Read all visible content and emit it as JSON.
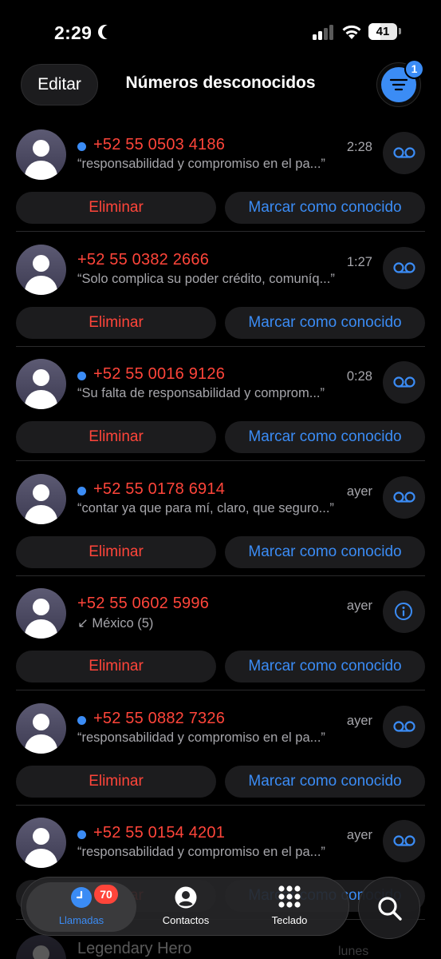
{
  "status_bar": {
    "time": "2:29",
    "battery": "41",
    "battery_level": 0.41
  },
  "header": {
    "edit_label": "Editar",
    "title": "Números desconocidos",
    "filter_badge": "1"
  },
  "actions": {
    "delete_label": "Eliminar",
    "mark_known_label": "Marcar como conocido"
  },
  "calls": [
    {
      "number": "+52 55 0503 4186",
      "subtitle": "“responsabilidad y compromiso en el pa...”",
      "time": "2:28",
      "unread": true,
      "side_icon": "voicemail-icon"
    },
    {
      "number": "+52 55 0382 2666",
      "subtitle": "“Solo complica su poder crédito, comuníq...”",
      "time": "1:27",
      "unread": false,
      "side_icon": "voicemail-icon"
    },
    {
      "number": "+52 55 0016 9126",
      "subtitle": "“Su falta de responsabilidad y comprom...”",
      "time": "0:28",
      "unread": true,
      "side_icon": "voicemail-icon"
    },
    {
      "number": "+52 55 0178 6914",
      "subtitle": "“contar ya que para mí, claro, que seguro...”",
      "time": "ayer",
      "unread": true,
      "side_icon": "voicemail-icon"
    },
    {
      "number": "+52 55 0602 5996",
      "subtitle": "↙ México (5)",
      "time": "ayer",
      "unread": false,
      "side_icon": "info-icon"
    },
    {
      "number": "+52 55 0882 7326",
      "subtitle": "“responsabilidad y compromiso en el pa...”",
      "time": "ayer",
      "unread": true,
      "side_icon": "voicemail-icon"
    },
    {
      "number": "+52 55 0154 4201",
      "subtitle": "“responsabilidad y compromiso en el pa...”",
      "time": "ayer",
      "unread": true,
      "side_icon": "voicemail-icon"
    }
  ],
  "peek": {
    "name": "Legendary Hero",
    "time": "lunes"
  },
  "tab_bar": {
    "tabs": [
      {
        "label": "Llamadas",
        "icon": "clock-icon",
        "active": true,
        "badge": "70"
      },
      {
        "label": "Contactos",
        "icon": "person-circle-icon",
        "active": false
      },
      {
        "label": "Teclado",
        "icon": "keypad-icon",
        "active": false
      }
    ],
    "search_icon": "search-icon"
  },
  "colors": {
    "accent": "#3b8cf5",
    "destructive": "#ff453a",
    "secondary_text": "#a6a6ab",
    "surface": "#1c1c1e"
  }
}
